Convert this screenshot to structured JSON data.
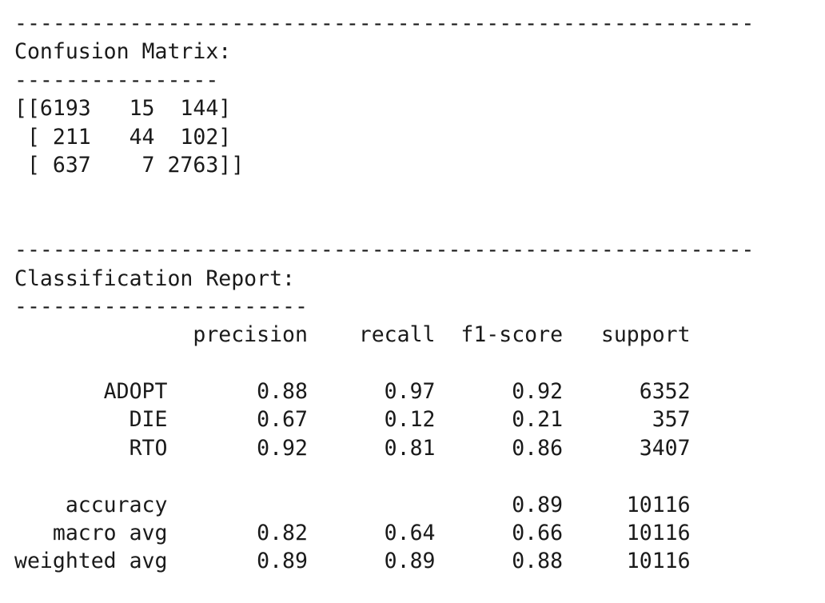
{
  "lines": [
    "----------------------------------------------------------",
    "Confusion Matrix:",
    "----------------",
    "[[6193   15  144]",
    " [ 211   44  102]",
    " [ 637    7 2763]]",
    "",
    "",
    "----------------------------------------------------------",
    "Classification Report:",
    "-----------------------",
    "              precision    recall  f1-score   support",
    "",
    "       ADOPT       0.88      0.97      0.92      6352",
    "         DIE       0.67      0.12      0.21       357",
    "         RTO       0.92      0.81      0.86      3407",
    "",
    "    accuracy                           0.89     10116",
    "   macro avg       0.82      0.64      0.66     10116",
    "weighted avg       0.89      0.89      0.88     10116"
  ]
}
